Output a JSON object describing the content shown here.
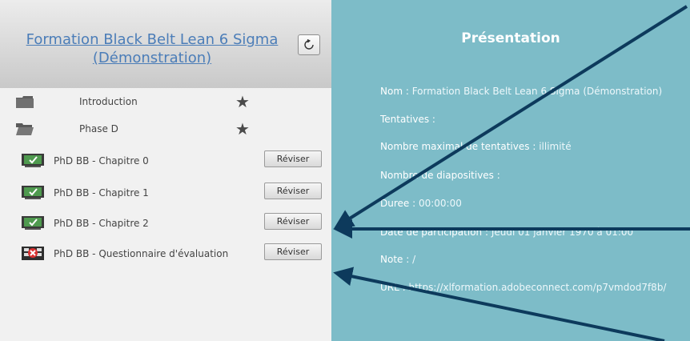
{
  "left_panel": {
    "course_title": "Formation Black Belt Lean 6 Sigma (Démonstration)",
    "refresh_icon": "refresh-icon",
    "folders": [
      {
        "label": "Introduction",
        "icon": "folder-closed-icon",
        "star": "star-icon"
      },
      {
        "label": "Phase D",
        "icon": "folder-open-icon",
        "star": "star-icon"
      }
    ],
    "lessons": [
      {
        "label": "PhD BB - Chapitre 0",
        "button": "Réviser",
        "icon": "presentation-complete-icon"
      },
      {
        "label": "PhD BB - Chapitre 1",
        "button": "Réviser",
        "icon": "presentation-complete-icon"
      },
      {
        "label": "PhD BB - Chapitre 2",
        "button": "Réviser",
        "icon": "presentation-complete-icon"
      },
      {
        "label": "PhD BB - Questionnaire d'évaluation",
        "button": "Réviser",
        "icon": "quiz-failed-icon"
      }
    ]
  },
  "right_panel": {
    "title": "Présentation",
    "fields": [
      {
        "key": "Nom : ",
        "value": "Formation Black Belt Lean 6 Sigma (Démonstration)"
      },
      {
        "key": "Tentatives : ",
        "value": ""
      },
      {
        "key": "Nombre maximal de tentatives : ",
        "value": "illimité"
      },
      {
        "key": "Nombre de diapositives : ",
        "value": ""
      },
      {
        "key": "Duree : ",
        "value": "00:00:00"
      },
      {
        "key": "Date de participation : ",
        "value": "Jeudi 01 janvier 1970 à 01:00"
      },
      {
        "key": "Note : ",
        "value": "/"
      },
      {
        "key": "URL : ",
        "value": "https://xlformation.adobeconnect.com/p7vmdod7f8b/"
      }
    ]
  },
  "colors": {
    "panel_bg": "#7dbcc8",
    "arrow": "#0d3a5c",
    "link": "#4b7db8"
  }
}
